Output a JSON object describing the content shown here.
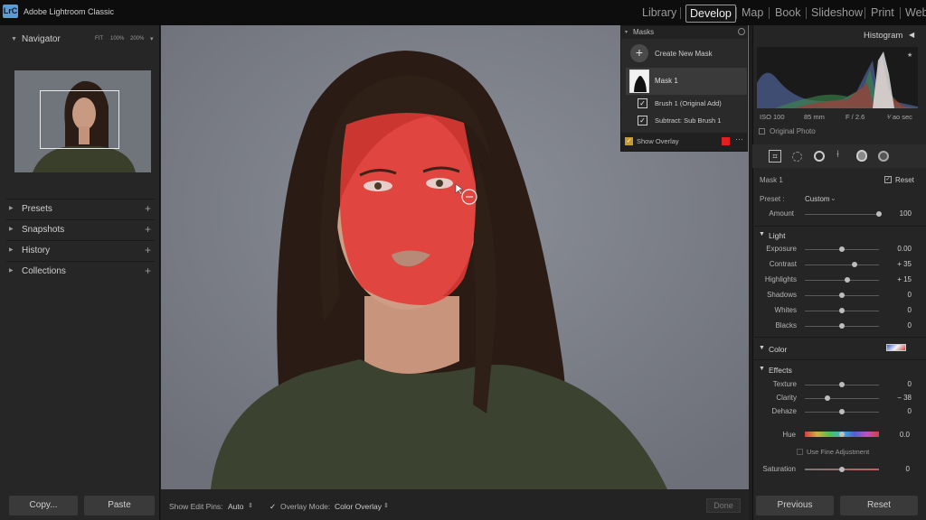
{
  "app": {
    "logo": "LrC",
    "title": "Adobe Lightroom Classic"
  },
  "modules": [
    {
      "label": "Library",
      "active": false
    },
    {
      "label": "Develop",
      "active": true
    },
    {
      "label": "Map",
      "active": false
    },
    {
      "label": "Book",
      "active": false
    },
    {
      "label": "Slideshow",
      "active": false
    },
    {
      "label": "Print",
      "active": false
    },
    {
      "label": "Web",
      "active": false
    }
  ],
  "navigator": {
    "title": "Navigator",
    "zoom_fit": "FIT",
    "zoom_100": "100%",
    "zoom_200": "200%"
  },
  "left_sections": [
    {
      "label": "Presets"
    },
    {
      "label": "Snapshots"
    },
    {
      "label": "History"
    },
    {
      "label": "Collections"
    }
  ],
  "left_buttons": {
    "copy": "Copy...",
    "paste": "Paste"
  },
  "toolbar": {
    "show_edit_pins_label": "Show Edit Pins:",
    "show_edit_pins_value": "Auto",
    "overlay_mode_label": "Overlay Mode:",
    "overlay_mode_value": "Color Overlay",
    "done": "Done"
  },
  "masks": {
    "title": "Masks",
    "create": "Create New Mask",
    "mask_name": "Mask 1",
    "components": [
      "Brush 1 (Original Add)",
      "Subtract: Sub Brush 1"
    ],
    "show_overlay": "Show Overlay",
    "overlay_color": "#e02020"
  },
  "histogram": {
    "title": "Histogram",
    "iso": "ISO 100",
    "focal": "85 mm",
    "aperture": "F / 2.6",
    "shutter": "¹⁄ ao sec",
    "original_photo": "Original Photo"
  },
  "mask_panel": {
    "mask_label": "Mask 1",
    "reset": "Reset",
    "preset_label": "Preset :",
    "preset_value": "Custom",
    "amount_label": "Amount",
    "amount_value": "100",
    "amount_level": 1.0
  },
  "light": {
    "title": "Light",
    "sliders": [
      {
        "label": "Exposure",
        "value": "0.00",
        "level": 0.5
      },
      {
        "label": "Contrast",
        "value": "+ 35",
        "level": 0.67
      },
      {
        "label": "Highlights",
        "value": "+ 15",
        "level": 0.57
      },
      {
        "label": "Shadows",
        "value": "0",
        "level": 0.5
      },
      {
        "label": "Whites",
        "value": "0",
        "level": 0.5
      },
      {
        "label": "Blacks",
        "value": "0",
        "level": 0.5
      }
    ]
  },
  "color_section": {
    "title": "Color"
  },
  "effects": {
    "title": "Effects",
    "sliders": [
      {
        "label": "Texture",
        "value": "0",
        "level": 0.5
      },
      {
        "label": "Clarity",
        "value": "− 38",
        "level": 0.31
      },
      {
        "label": "Dehaze",
        "value": "0",
        "level": 0.5
      }
    ]
  },
  "hue": {
    "label": "Hue",
    "value": "0.0",
    "level": 0.5,
    "fine": "Use Fine Adjustment"
  },
  "saturation": {
    "label": "Saturation",
    "value": "0",
    "level": 0.5
  },
  "right_buttons": {
    "previous": "Previous",
    "reset": "Reset"
  }
}
